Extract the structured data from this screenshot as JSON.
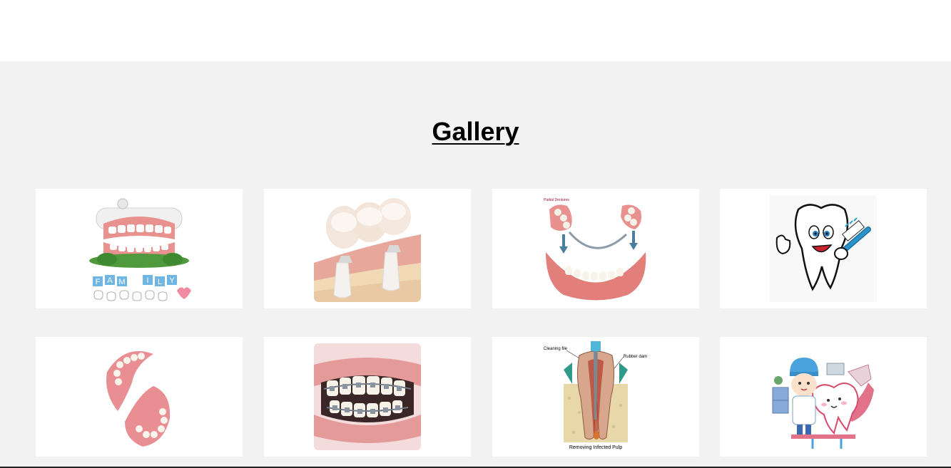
{
  "gallery": {
    "title": "Gallery",
    "images": [
      {
        "name": "family-teeth",
        "caption_letters": [
          "F",
          "A",
          "M",
          "I",
          "L",
          "Y"
        ]
      },
      {
        "name": "dental-bridge"
      },
      {
        "name": "partial-denture",
        "caption": "Partial Dentures"
      },
      {
        "name": "tooth-with-toothbrush"
      },
      {
        "name": "full-denture"
      },
      {
        "name": "braces-smile"
      },
      {
        "name": "root-canal",
        "label_file": "Cleaning file",
        "label_dam": "Rubber dam",
        "caption": "Removing Infected Pulp"
      },
      {
        "name": "dentist-cartoon"
      }
    ]
  },
  "colors": {
    "section_bg": "#f2f2f2",
    "card_bg": "#ffffff",
    "gum": "#e8918f",
    "tooth": "#f7f5f0"
  }
}
